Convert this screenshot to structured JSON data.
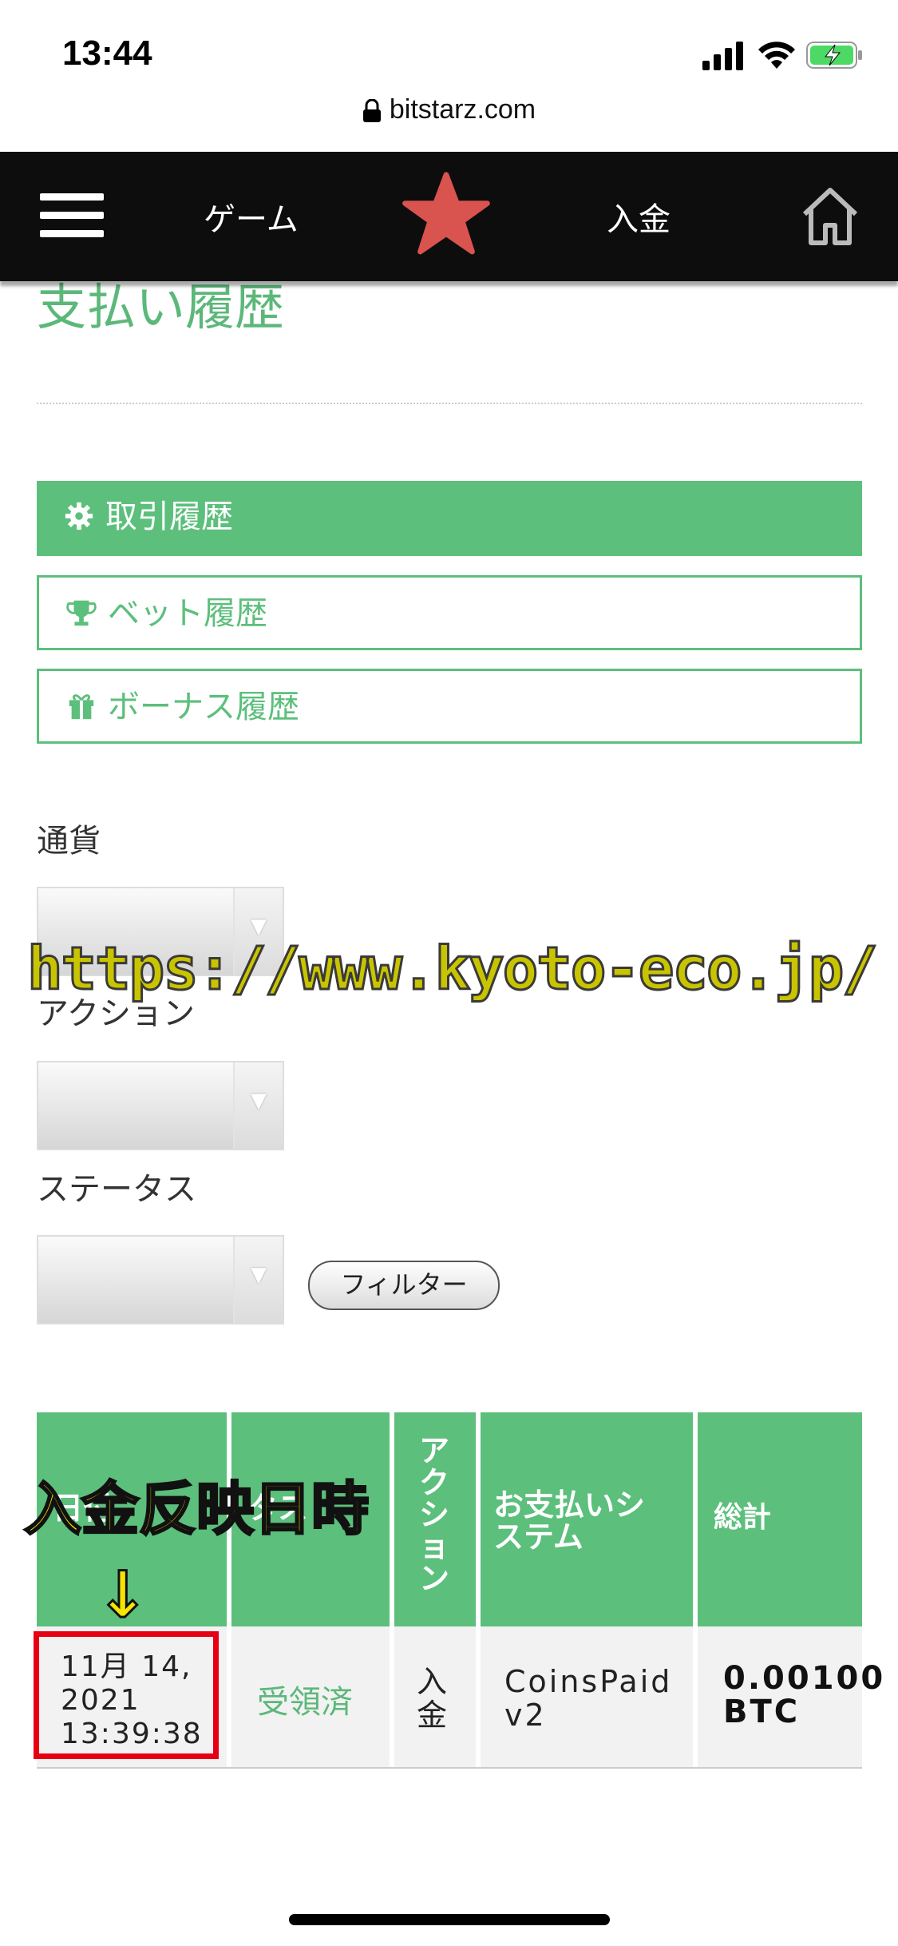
{
  "status_bar": {
    "time": "13:44"
  },
  "url_bar": {
    "domain": "bitstarz.com"
  },
  "navbar": {
    "game_label": "ゲーム",
    "deposit_label": "入金",
    "star_color": "#d9534f"
  },
  "page": {
    "title": "支払い履歴"
  },
  "tabs": [
    {
      "label": "取引履歴",
      "icon": "gear-icon",
      "active": true
    },
    {
      "label": "ベット履歴",
      "icon": "trophy-icon",
      "active": false
    },
    {
      "label": "ボーナス履歴",
      "icon": "gift-icon",
      "active": false
    }
  ],
  "filters": {
    "currency_label": "通貨",
    "action_label": "アクション",
    "status_label": "ステータス",
    "filter_button": "フィルター"
  },
  "watermark": "https://www.kyoto-eco.jp/",
  "annotation": {
    "label": "入金反映日時",
    "arrow": "↓"
  },
  "table": {
    "headers": [
      "日付",
      "ステータス",
      "アクション",
      "お支払いシステム",
      "総計"
    ],
    "header_col1_visible": "日付",
    "header_col2_visible": "タス",
    "header_col3": [
      "ア",
      "ク",
      "シ",
      "ョ",
      "ン"
    ],
    "header_col4": [
      "お支払いシ",
      "ステム"
    ],
    "rows": [
      {
        "date_line1": "11月 14,",
        "date_line2": "2021",
        "date_line3": "13:39:38",
        "status": "受領済",
        "action_line1": "入",
        "action_line2": "金",
        "system_line1": "CoinsPaid",
        "system_line2": "v2",
        "total_line1": "0.00100",
        "total_line2": "BTC"
      }
    ]
  },
  "colors": {
    "accent": "#5cbf7c",
    "navbar_bg": "#0d0d0d",
    "highlight": "#e60012",
    "annotation": "#f5e600"
  }
}
